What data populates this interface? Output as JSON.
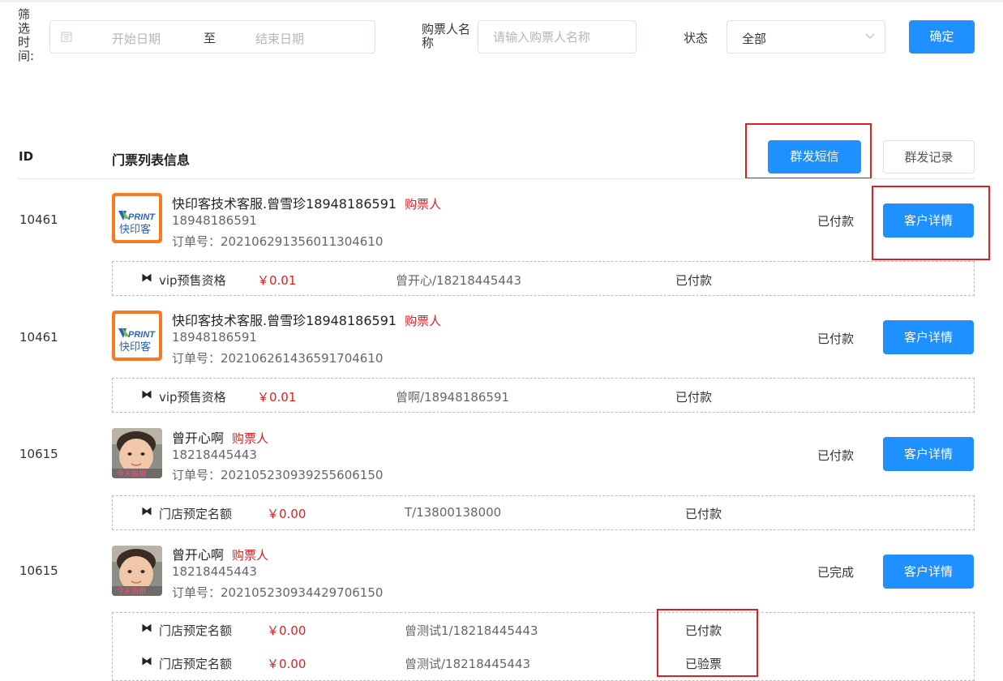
{
  "filters": {
    "date_label": "筛选时间:",
    "date_start_placeholder": "开始日期",
    "date_separator": "至",
    "date_end_placeholder": "结束日期",
    "buyer_label": "购票人名称",
    "buyer_placeholder": "请输入购票人名称",
    "status_label": "状态",
    "status_value": "全部",
    "confirm_label": "确定"
  },
  "list_header": {
    "id_label": "ID",
    "info_label": "门票列表信息",
    "mass_sms_label": "群发短信",
    "mass_record_label": "群发记录"
  },
  "orders": [
    {
      "id": "10461",
      "avatar": "kuaiyinke-logo",
      "name": "快印客技术客服.曾雪珍18948186591",
      "tag": "购票人",
      "phone": "18948186591",
      "order_no": "订单号：20210629135601130461​0",
      "status": "已付款",
      "detail_label": "客户详情",
      "tickets": [
        {
          "icon": "ticket-icon",
          "name": "vip预售资格",
          "price": "￥0.01",
          "holder": "曾开心/18218445443",
          "status": "已付款"
        }
      ]
    },
    {
      "id": "10461",
      "avatar": "kuaiyinke-logo",
      "name": "快印客技术客服.曾雪珍18948186591",
      "tag": "购票人",
      "phone": "18948186591",
      "order_no": "订单号：20210626143659170461​0",
      "status": "已付款",
      "detail_label": "客户详情",
      "tickets": [
        {
          "icon": "ticket-icon",
          "name": "vip预售资格",
          "price": "￥0.01",
          "holder": "曾啊/18948186591",
          "status": "已付款"
        }
      ]
    },
    {
      "id": "10615",
      "avatar": "child-photo",
      "name": "曾开心啊",
      "tag": "购票人",
      "phone": "18218445443",
      "order_no": "订单号：202105230939255606150",
      "status": "已付款",
      "detail_label": "客户详情",
      "tickets": [
        {
          "icon": "ticket-icon",
          "name": "门店预定名额",
          "price": "￥0.00",
          "holder": "T/13800138000",
          "status": "已付款"
        }
      ]
    },
    {
      "id": "10615",
      "avatar": "child-photo",
      "name": "曾开心啊",
      "tag": "购票人",
      "phone": "18218445443",
      "order_no": "订单号：202105230934429706150",
      "status": "已完成",
      "detail_label": "客户详情",
      "tickets": [
        {
          "icon": "ticket-icon",
          "name": "门店预定名额",
          "price": "￥0.00",
          "holder": "曾测试1/18218445443",
          "status": "已付款"
        },
        {
          "icon": "ticket-icon",
          "name": "门店预定名额",
          "price": "￥0.00",
          "holder": "曾测试/18218445443",
          "status": "已验票"
        }
      ]
    }
  ],
  "logo_text": {
    "brand_en": "PRINT",
    "brand_cn": "快印客"
  },
  "photo_caption": "今天拍相",
  "colors": {
    "primary": "#1e90ff",
    "accent_red": "#e02020",
    "border": "#dcdfe6"
  }
}
